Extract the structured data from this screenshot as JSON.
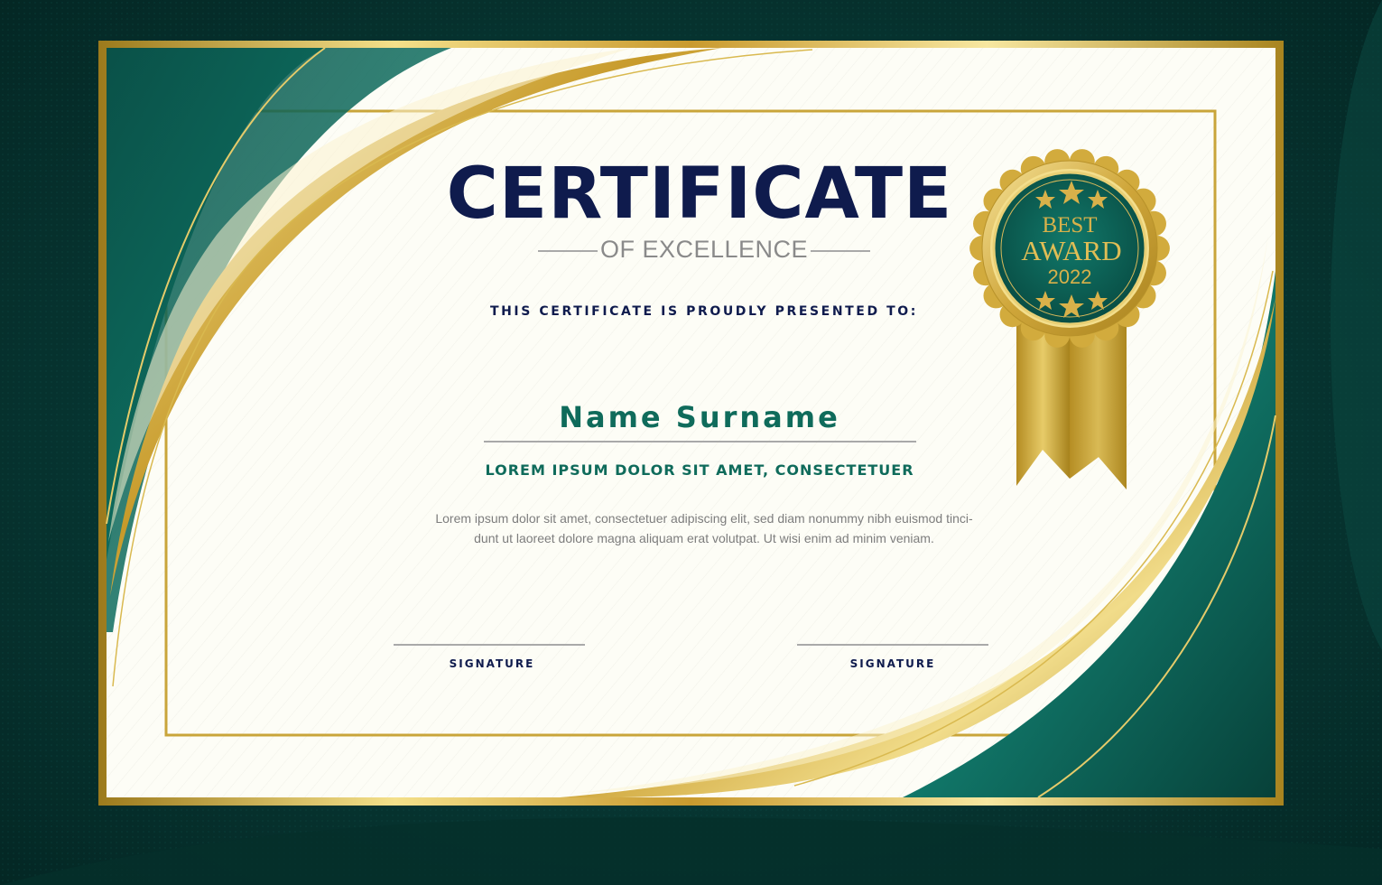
{
  "certificate": {
    "title": "CERTIFICATE",
    "subtitle": "OF EXCELLENCE",
    "presented_to": "THIS CERTIFICATE IS PROUDLY PRESENTED TO:",
    "recipient_name": "Name Surname",
    "reason": "LOREM IPSUM DOLOR SIT AMET, CONSECTETUER",
    "body_line_1": "Lorem ipsum dolor sit amet, consectetuer adipiscing elit, sed diam nonummy nibh euismod tinci-",
    "body_line_2": "dunt ut laoreet dolore magna aliquam erat volutpat. Ut wisi enim ad minim veniam.",
    "signature_left_label": "SIGNATURE",
    "signature_right_label": "SIGNATURE"
  },
  "award_seal": {
    "line_1": "BEST",
    "line_2": "AWARD",
    "line_3": "2022",
    "icons": [
      "star-icon",
      "ribbon-icon",
      "rosette-icon"
    ]
  },
  "colors": {
    "background_green": "#073632",
    "frame_green": "#0b5a50",
    "gold": "#c9a53a",
    "title_navy": "#0f1b4d",
    "name_teal": "#0f6b5b",
    "paper": "#fdfdf6"
  }
}
